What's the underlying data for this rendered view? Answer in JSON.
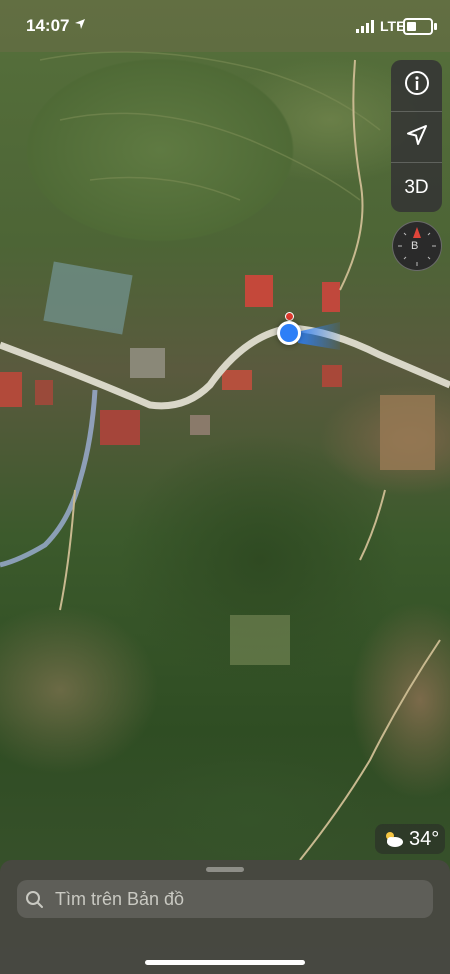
{
  "status_bar": {
    "time": "14:07",
    "network": "LTE",
    "icons": [
      "location-arrow-icon",
      "signal-icon",
      "battery-icon"
    ]
  },
  "map_controls": {
    "info_icon": "info-icon",
    "tracking_icon": "location-arrow-icon",
    "view_3d_label": "3D",
    "compass_letter": "B"
  },
  "weather": {
    "icon": "partly-cloudy-icon",
    "temperature": "34°"
  },
  "search": {
    "placeholder": "Tìm trên Bản đồ",
    "value": ""
  },
  "colors": {
    "location_dot": "#2d7ff7",
    "control_bg": "#343434",
    "road": "#d9d7c8"
  }
}
